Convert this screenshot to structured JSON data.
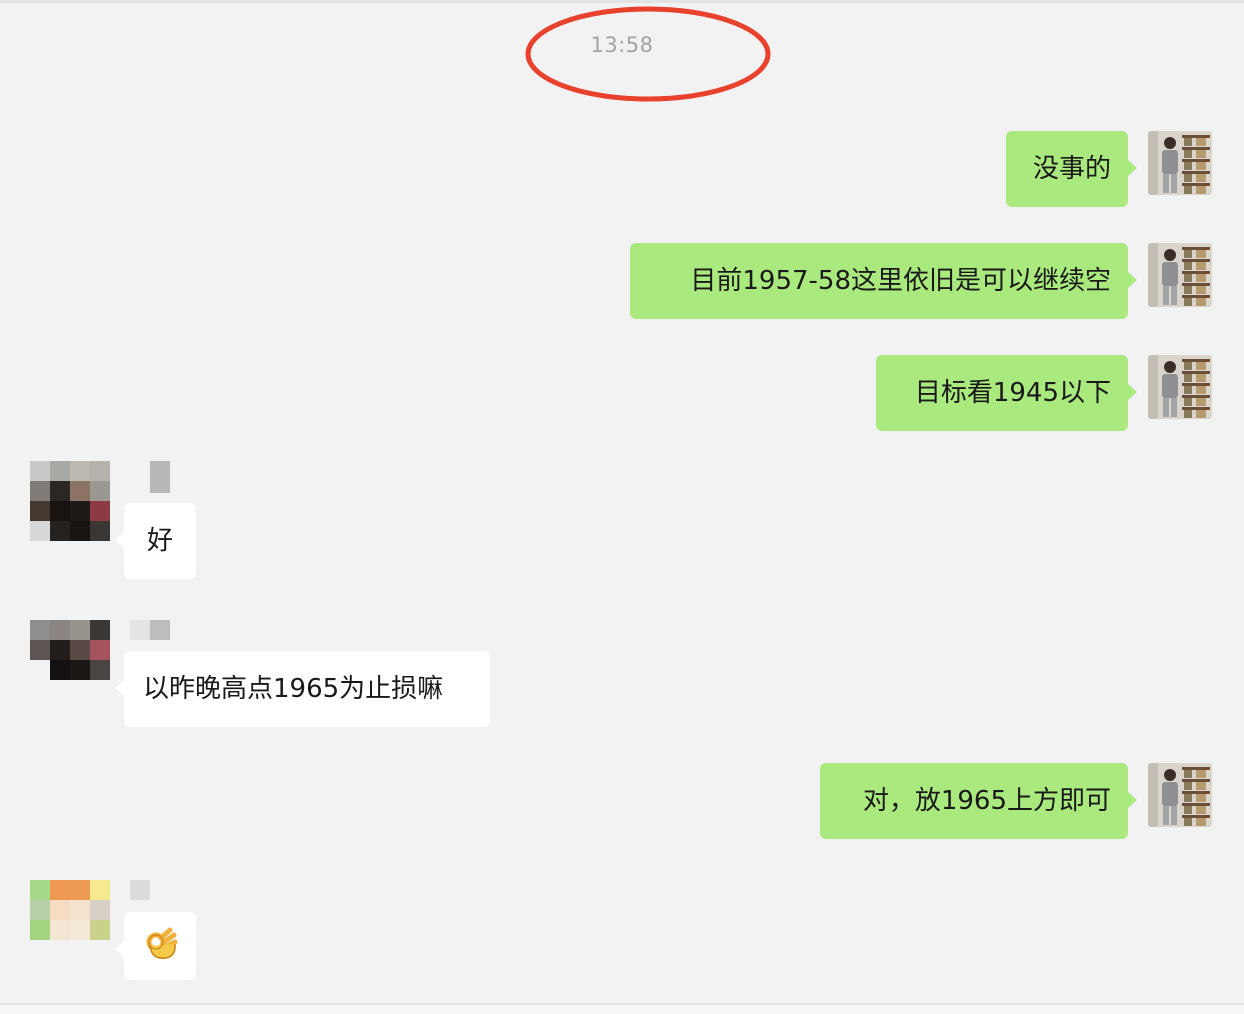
{
  "chat": {
    "timestamp": "13:58",
    "highlight_color": "#e8412c",
    "outgoing_bubble_color": "#a9e97e",
    "incoming_bubble_color": "#ffffff",
    "messages": [
      {
        "direction": "outgoing",
        "text": "没事的",
        "avatar": "self-avatar"
      },
      {
        "direction": "outgoing",
        "text": "目前1957-58这里依旧是可以继续空",
        "avatar": "self-avatar"
      },
      {
        "direction": "outgoing",
        "text": "目标看1945以下",
        "avatar": "self-avatar"
      },
      {
        "direction": "incoming",
        "text": "好",
        "avatar": "pixelated-avatar",
        "sender_name_obscured": true
      },
      {
        "direction": "incoming",
        "text": "以昨晚高点1965为止损嘛",
        "avatar": "pixelated-avatar",
        "sender_name_obscured": true
      },
      {
        "direction": "outgoing",
        "text": "对，放1965上方即可",
        "avatar": "self-avatar"
      },
      {
        "direction": "incoming",
        "text": "",
        "emoji": "ok-hand-icon",
        "avatar": "pixelated-avatar",
        "sender_name_obscured": true
      }
    ]
  }
}
